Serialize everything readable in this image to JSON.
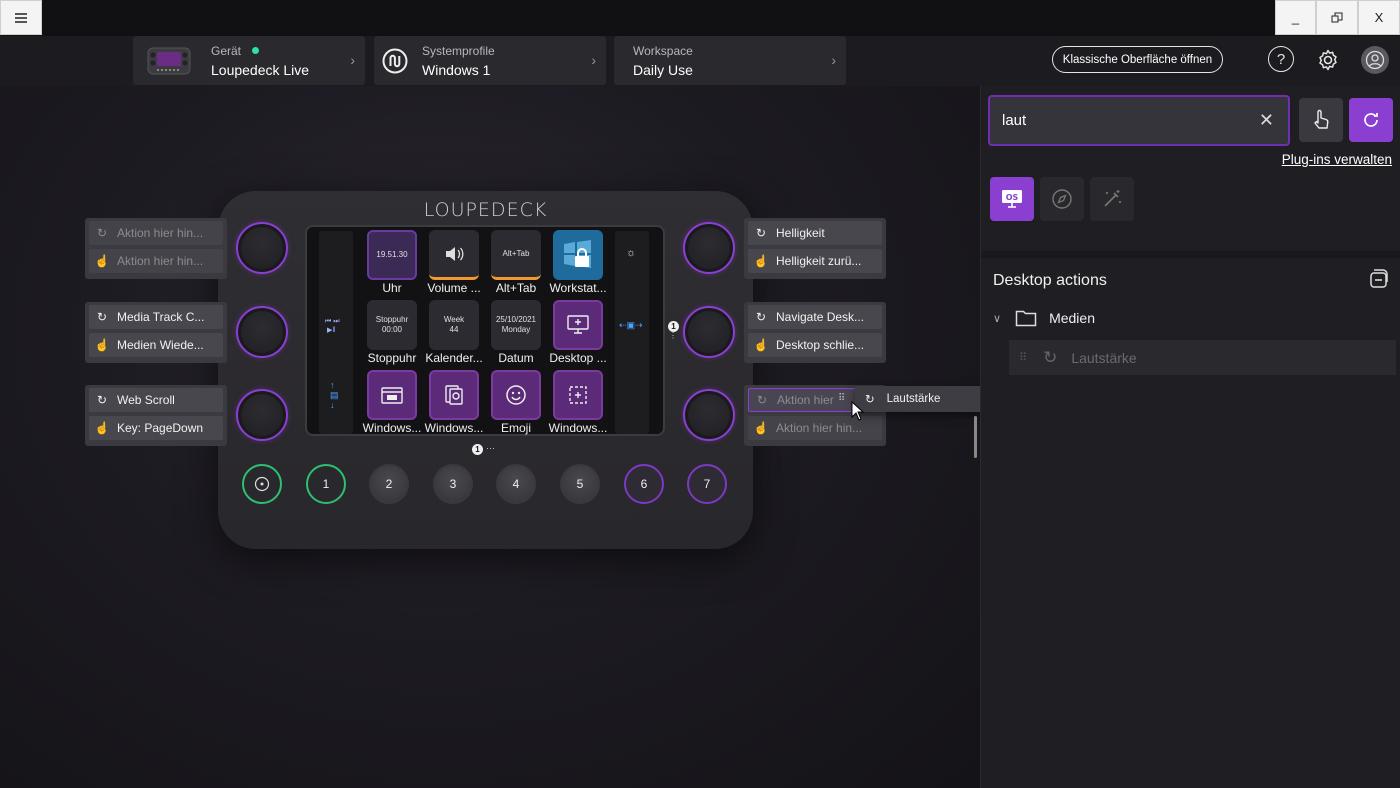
{
  "titlebar": {
    "menu_icon": "hamburger-icon",
    "minimize": "_",
    "close": "X"
  },
  "header": {
    "device": {
      "key": "Gerät",
      "value": "Loupedeck Live",
      "status_color": "#2fe0a0"
    },
    "profile": {
      "key": "Systemprofile",
      "value": "Windows 1"
    },
    "workspace": {
      "key": "Workspace",
      "value": "Daily Use"
    },
    "classic_button": "Klassische Oberfläche öffnen",
    "help": "?"
  },
  "device": {
    "logo": "LOUPEDECK",
    "tiles": [
      {
        "text": "19.51.30",
        "label": "Uhr"
      },
      {
        "text": "",
        "label": "Volume ..."
      },
      {
        "text": "Alt+Tab",
        "label": "Alt+Tab"
      },
      {
        "text": "",
        "label": "Workstat..."
      },
      {
        "text": "Stoppuhr\n00:00",
        "label": "Stoppuhr"
      },
      {
        "text": "Week\n44",
        "label": "Kalender..."
      },
      {
        "text": "25/10/2021\nMonday",
        "label": "Datum"
      },
      {
        "text": "",
        "label": "Desktop ..."
      },
      {
        "text": "",
        "label": "Windows..."
      },
      {
        "text": "",
        "label": "Windows..."
      },
      {
        "text": "",
        "label": "Emoji"
      },
      {
        "text": "",
        "label": "Windows..."
      }
    ],
    "buttons": [
      "1",
      "2",
      "3",
      "4",
      "5",
      "6",
      "7"
    ],
    "page_badge": "1",
    "page_dots": "···",
    "side_badge": "1"
  },
  "left_actions": [
    {
      "rotate": "Aktion hier hin...",
      "press": "Aktion hier hin..."
    },
    {
      "rotate": "Media Track C...",
      "press": "Medien Wiede..."
    },
    {
      "rotate": "Web Scroll",
      "press": "Key: PageDown"
    }
  ],
  "right_actions": [
    {
      "rotate": "Helligkeit",
      "press": "Helligkeit zurü..."
    },
    {
      "rotate": "Navigate Desk...",
      "press": "Desktop schlie..."
    },
    {
      "rotate": "Aktion hier",
      "press": "Aktion hier hin..."
    }
  ],
  "drag_ghost": "Lautstärke",
  "panel": {
    "search_value": "laut",
    "manage_link": "Plug-ins verwalten",
    "section_title": "Desktop actions",
    "folder": "Medien",
    "item": "Lautstärke",
    "accent": "#8a3fd1"
  }
}
